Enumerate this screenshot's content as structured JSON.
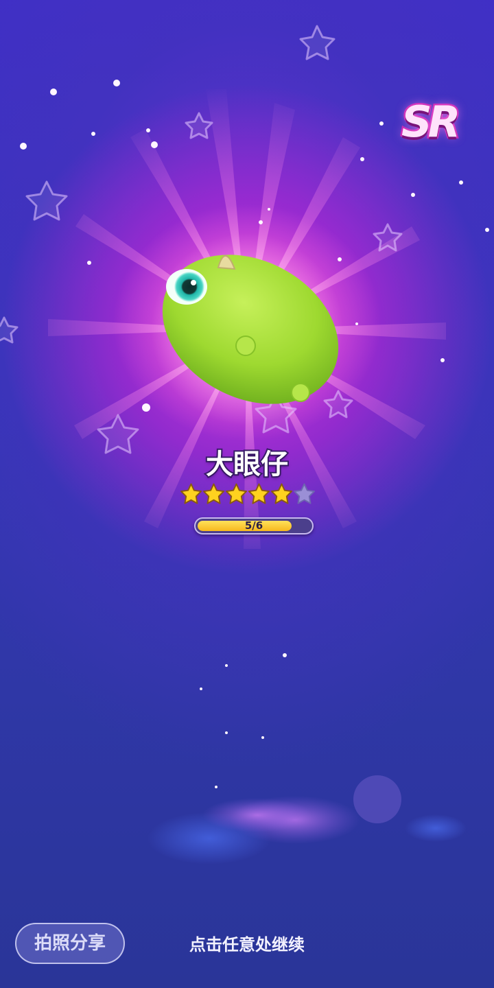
{
  "rarity_badge": "SR",
  "pet": {
    "name": "大眼仔",
    "stars_filled": 5,
    "stars_total": 6,
    "progress_label": "5/6",
    "progress_fraction": 0.833
  },
  "share_button_label": "拍照分享",
  "continue_hint": "点击任意处继续",
  "colors": {
    "background": "#2b2f9a",
    "glow": "#e24fd8",
    "star": "#ffd21f",
    "progress": "#f7c21f",
    "pet_body": "#9ed930"
  },
  "icons": {
    "pet": "green-one-eyed-monster",
    "star": "star-icon",
    "decoration": "outline-star-icon"
  }
}
